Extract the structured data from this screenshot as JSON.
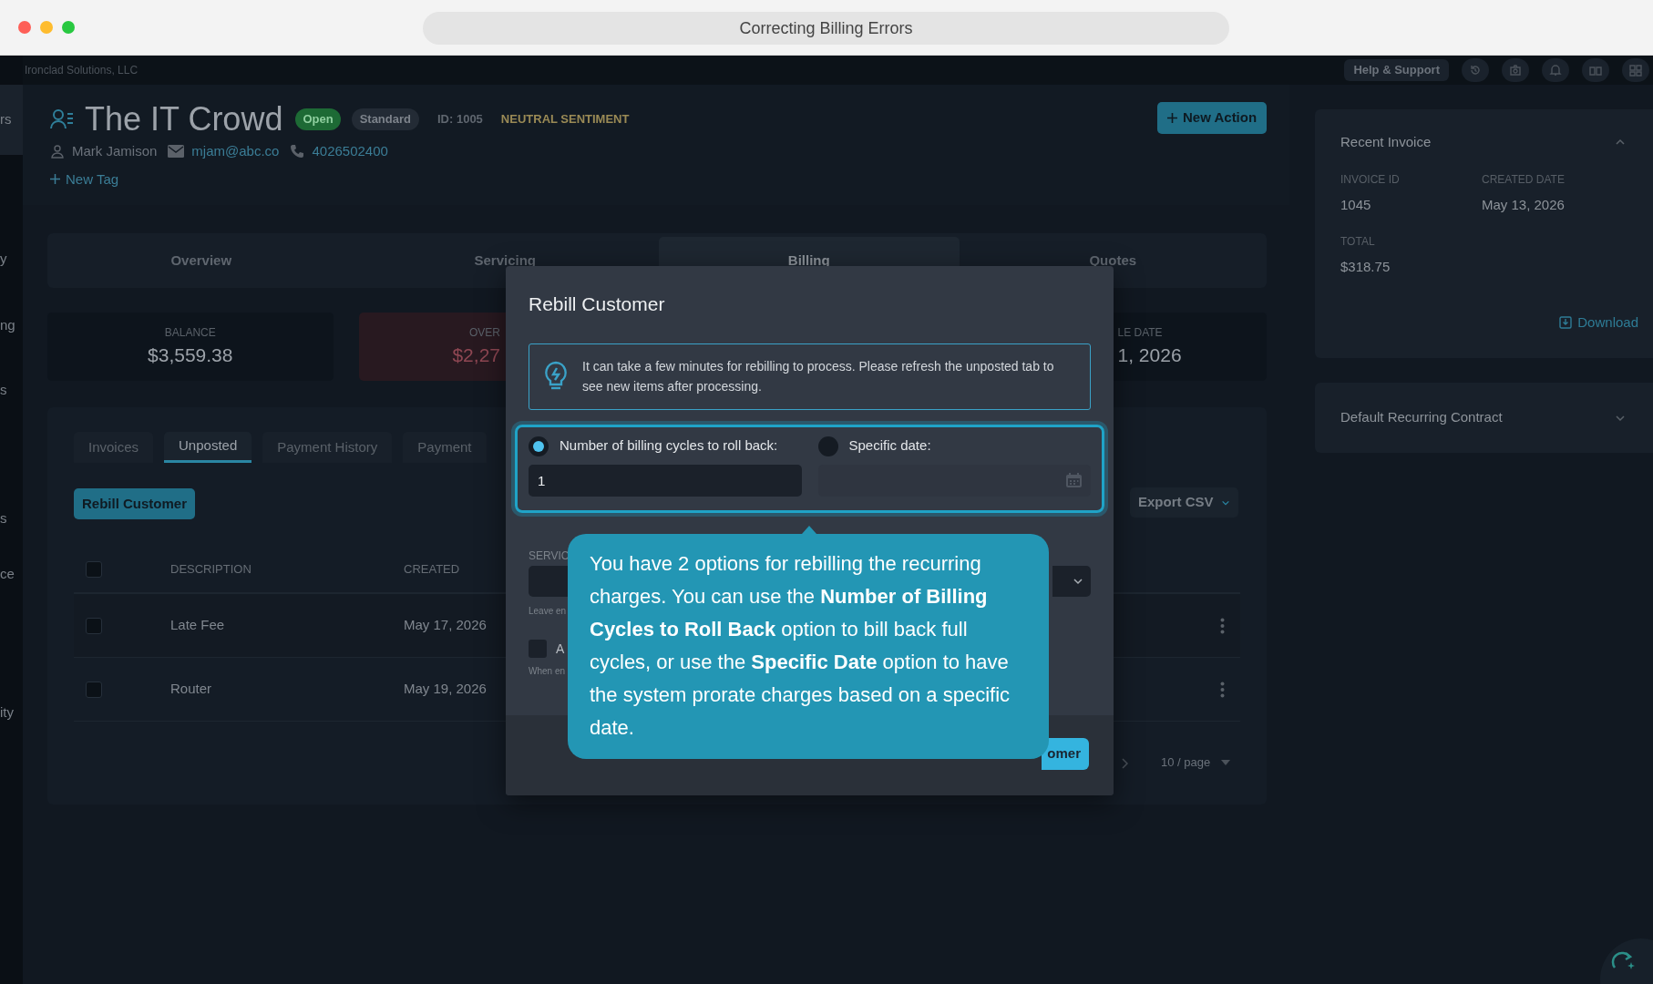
{
  "browser": {
    "title": "Correcting Billing Errors"
  },
  "topbar": {
    "company": "Ironclad Solutions, LLC",
    "help_button": "Help & Support"
  },
  "sidebar": {
    "items": [
      {
        "label": "rs",
        "selected": true
      },
      {
        "label": "y",
        "selected": false
      },
      {
        "label": "ng",
        "selected": false
      },
      {
        "label": "s",
        "selected": false
      },
      {
        "label": "s",
        "selected": false
      },
      {
        "label": "ce",
        "selected": false
      },
      {
        "label": "ity",
        "selected": false
      }
    ]
  },
  "customer": {
    "name": "The IT Crowd",
    "status": "Open",
    "plan": "Standard",
    "id": "ID: 1005",
    "sentiment": "NEUTRAL SENTIMENT",
    "contact": "Mark Jamison",
    "email": "mjam@abc.co",
    "phone": "4026502400",
    "new_tag": "New Tag",
    "new_action": "New Action"
  },
  "tabs": [
    {
      "label": "Overview",
      "selected": false
    },
    {
      "label": "Servicing",
      "selected": false
    },
    {
      "label": "Billing",
      "selected": true
    },
    {
      "label": "Quotes",
      "selected": false
    }
  ],
  "stats": [
    {
      "label": "BALANCE",
      "value": "$3,559.38",
      "kind": "normal"
    },
    {
      "label": "OVER",
      "value": "$2,27",
      "kind": "alert"
    },
    {
      "label": "LE DATE",
      "value": "1, 2026",
      "kind": "normal"
    }
  ],
  "subtabs": [
    {
      "label": "Invoices",
      "selected": false
    },
    {
      "label": "Unposted",
      "selected": true
    },
    {
      "label": "Payment History",
      "selected": false
    },
    {
      "label": "Payment",
      "selected": false
    }
  ],
  "rebill_button": "Rebill Customer",
  "export_button": "Export CSV",
  "table": {
    "select_all": {
      "checked": false
    },
    "columns": [
      "DESCRIPTION",
      "CREATED"
    ],
    "rows": [
      {
        "cells": [
          "Late Fee",
          "May 17, 2026"
        ],
        "checked": false
      },
      {
        "cells": [
          "Router",
          "May 19, 2026"
        ],
        "checked": false
      }
    ]
  },
  "pagination": {
    "page_size": "10 / page"
  },
  "recent_invoice": {
    "title": "Recent Invoice",
    "expanded": true,
    "fields": [
      {
        "label": "INVOICE ID",
        "value": "1045"
      },
      {
        "label": "CREATED DATE",
        "value": "May 13, 2026"
      },
      {
        "label": "TOTAL",
        "value": "$318.75"
      }
    ],
    "download": "Download"
  },
  "contract": {
    "title": "Default Recurring Contract",
    "expanded": false
  },
  "modal": {
    "title": "Rebill Customer",
    "info": "It can take a few minutes for rebilling to process. Please refresh the unposted tab to see new items after processing.",
    "options": [
      {
        "label": "Number of billing cycles to roll back:",
        "selected": true,
        "value": "1"
      },
      {
        "label": "Specific date:",
        "selected": false
      }
    ],
    "service_label": "SERVIC",
    "service_help": "Leave en",
    "checkbox": {
      "label": "A",
      "checked": false
    },
    "checkbox_help": "When en",
    "submit": "omer"
  },
  "tooltip": {
    "text": "You have 2 options for rebilling the recurring charges. You can use the **Number of Billing Cycles to Roll Back** option to bill back full cycles, or use the **Specific Date** option to have the system prorate charges based on a specific date."
  }
}
